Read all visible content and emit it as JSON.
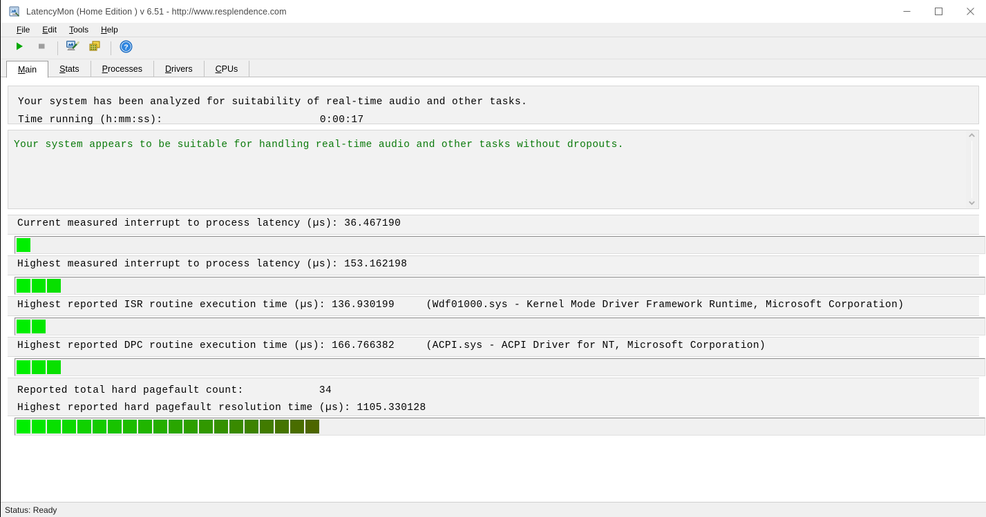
{
  "window": {
    "title": "LatencyMon  (Home Edition )  v 6.51 - http://www.resplendence.com",
    "icon": "latencymon-app-icon",
    "controls": {
      "minimize": "minimize-icon",
      "maximize": "maximize-icon",
      "close": "close-icon"
    }
  },
  "menubar": {
    "items": [
      {
        "label": "File",
        "mnemonic": "F"
      },
      {
        "label": "Edit",
        "mnemonic": "E"
      },
      {
        "label": "Tools",
        "mnemonic": "T"
      },
      {
        "label": "Help",
        "mnemonic": "H"
      }
    ]
  },
  "toolbar": {
    "buttons": [
      {
        "name": "start-monitoring-button",
        "icon": "play-icon",
        "label": "Start"
      },
      {
        "name": "stop-monitoring-button",
        "icon": "stop-icon",
        "label": "Stop"
      },
      {
        "name": "system-analysis-button",
        "icon": "monitor-wand-icon",
        "label": "Analyze"
      },
      {
        "name": "copy-report-button",
        "icon": "copy-layers-icon",
        "label": "Copy"
      },
      {
        "name": "help-button",
        "icon": "help-circle-icon",
        "label": "Help"
      }
    ]
  },
  "tabs": {
    "active": "Main",
    "items": [
      {
        "label": "Main",
        "mnemonic": "M"
      },
      {
        "label": "Stats",
        "mnemonic": "S"
      },
      {
        "label": "Processes",
        "mnemonic": "P"
      },
      {
        "label": "Drivers",
        "mnemonic": "D"
      },
      {
        "label": "CPUs",
        "mnemonic": "C"
      }
    ]
  },
  "summary": {
    "headline": "Your system has been analyzed for suitability of real-time audio and other tasks.",
    "time_label": "Time running (h:mm:ss):",
    "time_value": "0:00:17"
  },
  "verdict": {
    "text": "Your system appears to be suitable for handling real-time audio and other tasks without dropouts.",
    "color": "#0a7a0a",
    "scroll_up_icon": "chevron-up-icon",
    "scroll_down_icon": "chevron-down-icon"
  },
  "metrics": [
    {
      "name": "current-interrupt-to-process-latency",
      "label": "Current measured interrupt to process latency (µs):",
      "value": "36.467190",
      "extra": "",
      "bar_segments": 1
    },
    {
      "name": "highest-interrupt-to-process-latency",
      "label": "Highest measured interrupt to process latency (µs):",
      "value": "153.162198",
      "extra": "",
      "bar_segments": 3
    },
    {
      "name": "highest-isr-routine-execution-time",
      "label": "Highest reported ISR routine execution time (µs):",
      "value": "136.930199",
      "extra": "(Wdf01000.sys - Kernel Mode Driver Framework Runtime, Microsoft Corporation)",
      "bar_segments": 2
    },
    {
      "name": "highest-dpc-routine-execution-time",
      "label": "Highest reported DPC routine execution time (µs):",
      "value": "166.766382",
      "extra": "(ACPI.sys - ACPI Driver for NT, Microsoft Corporation)",
      "bar_segments": 3
    }
  ],
  "pagefault": {
    "count_label": "Reported total hard pagefault count:",
    "count_value": "34",
    "time_label": "Highest reported hard pagefault resolution time (µs):",
    "time_value": "1105.330128",
    "bar_segments": 20
  },
  "bar_colors": {
    "start": "#00ee00",
    "end": "#4d6600"
  },
  "statusbar": {
    "text": "Status: Ready"
  }
}
